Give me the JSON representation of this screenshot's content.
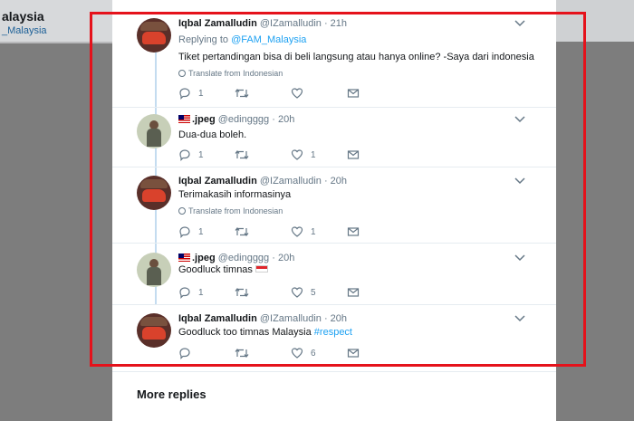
{
  "background": {
    "profile_name": "alaysia",
    "profile_handle": "_Malaysia"
  },
  "colors": {
    "accent": "#1da1f2",
    "annotation": "#e5121b"
  },
  "tweets": [
    {
      "name": "Iqbal Zamalludin",
      "handle": "@IZamalludin",
      "time": "· 21h",
      "avatar": "car",
      "replying_prefix": "Replying to ",
      "replying_to": "@FAM_Malaysia",
      "text": "Tiket pertandingan bisa di beli langsung atau hanya online? -Saya dari indonesia",
      "translate": "Translate from Indonesian",
      "replies": "1",
      "likes": ""
    },
    {
      "name": ".jpeg",
      "handle": "@edingggg",
      "time": "· 20h",
      "avatar": "person",
      "flag": "malaysia-flag",
      "text": "Dua-dua boleh.",
      "replies": "1",
      "likes": "1"
    },
    {
      "name": "Iqbal Zamalludin",
      "handle": "@IZamalludin",
      "time": "· 20h",
      "avatar": "car",
      "text": "Terimakasih informasinya",
      "translate": "Translate from Indonesian",
      "replies": "1",
      "likes": "1"
    },
    {
      "name": ".jpeg",
      "handle": "@edingggg",
      "time": "· 20h",
      "avatar": "person",
      "flag": "malaysia-flag",
      "text": "Goodluck timnas",
      "text_flag": "indonesia-flag",
      "replies": "1",
      "likes": "5"
    },
    {
      "name": "Iqbal Zamalludin",
      "handle": "@IZamalludin",
      "time": "· 20h",
      "avatar": "car",
      "text": "Goodluck too timnas Malaysia ",
      "hashtag": "#respect",
      "replies": "",
      "likes": "6"
    }
  ],
  "more_replies": "More replies"
}
